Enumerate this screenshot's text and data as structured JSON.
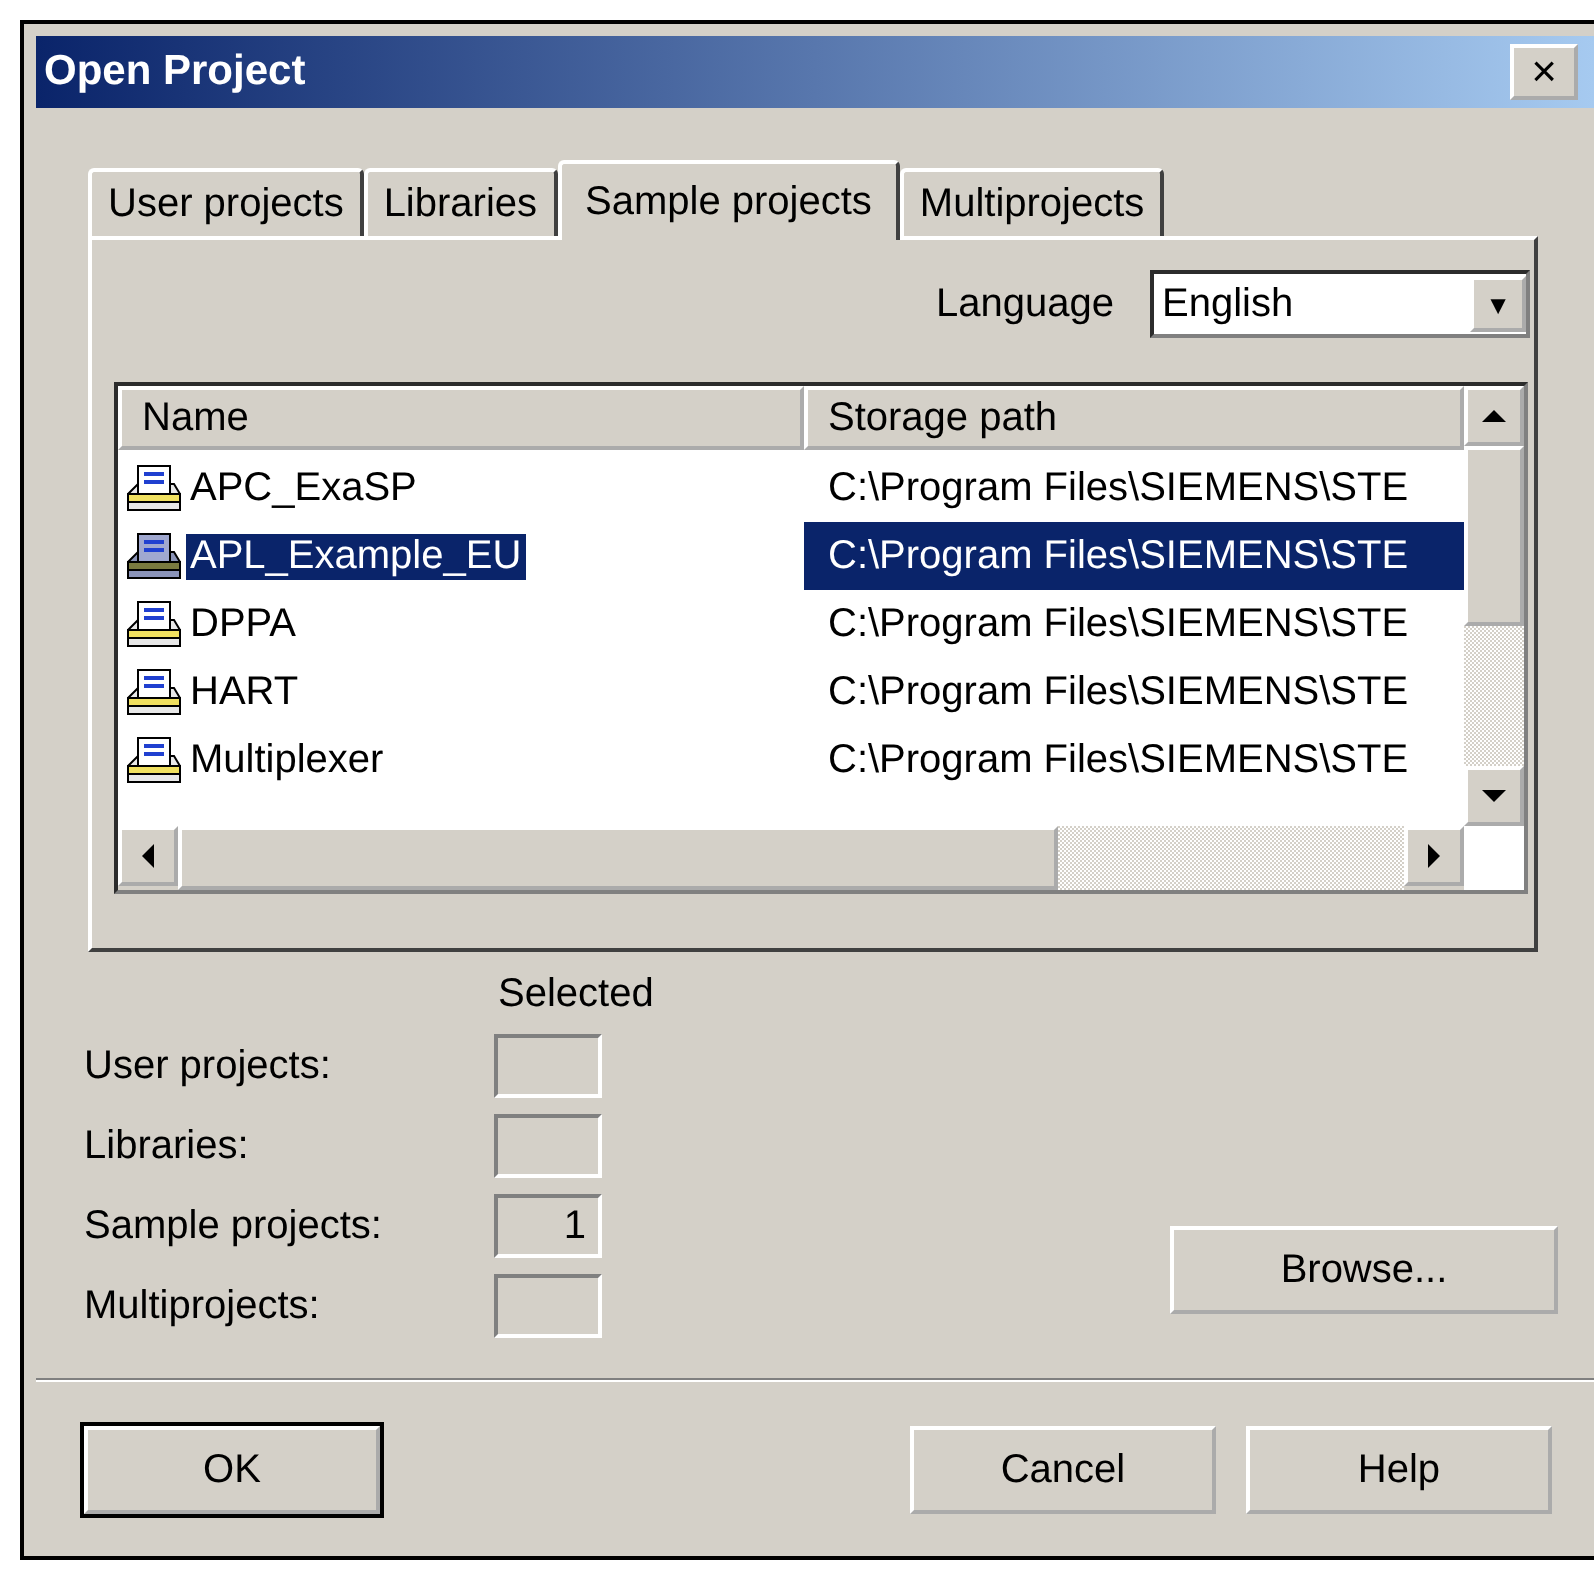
{
  "window": {
    "title": "Open Project",
    "close": "×"
  },
  "tabs": [
    {
      "label": "User projects",
      "selected": false
    },
    {
      "label": "Libraries",
      "selected": false
    },
    {
      "label": "Sample projects",
      "selected": true
    },
    {
      "label": "Multiprojects",
      "selected": false
    }
  ],
  "language": {
    "label": "Language",
    "value": "English",
    "arrow": "▼"
  },
  "table": {
    "columns": [
      "Name",
      "Storage path"
    ],
    "rows": [
      {
        "name": "APC_ExaSP",
        "path": "C:\\Program Files\\SIEMENS\\STE",
        "selected": false
      },
      {
        "name": "APL_Example_EU",
        "path": "C:\\Program Files\\SIEMENS\\STE",
        "selected": true
      },
      {
        "name": "DPPA",
        "path": "C:\\Program Files\\SIEMENS\\STE",
        "selected": false
      },
      {
        "name": "HART",
        "path": "C:\\Program Files\\SIEMENS\\STE",
        "selected": false
      },
      {
        "name": "Multiplexer",
        "path": "C:\\Program Files\\SIEMENS\\STE",
        "selected": false
      }
    ]
  },
  "selected_heading": "Selected",
  "counts": [
    {
      "label": "User projects:"
    },
    {
      "label": "Libraries:"
    },
    {
      "label": "Sample projects:",
      "value": "1"
    },
    {
      "label": "Multiprojects:"
    }
  ],
  "browse_button": "Browse...",
  "buttons": [
    {
      "label": "OK",
      "default": true
    },
    {
      "label": "Cancel",
      "default": false
    },
    {
      "label": "Help",
      "default": false
    }
  ]
}
